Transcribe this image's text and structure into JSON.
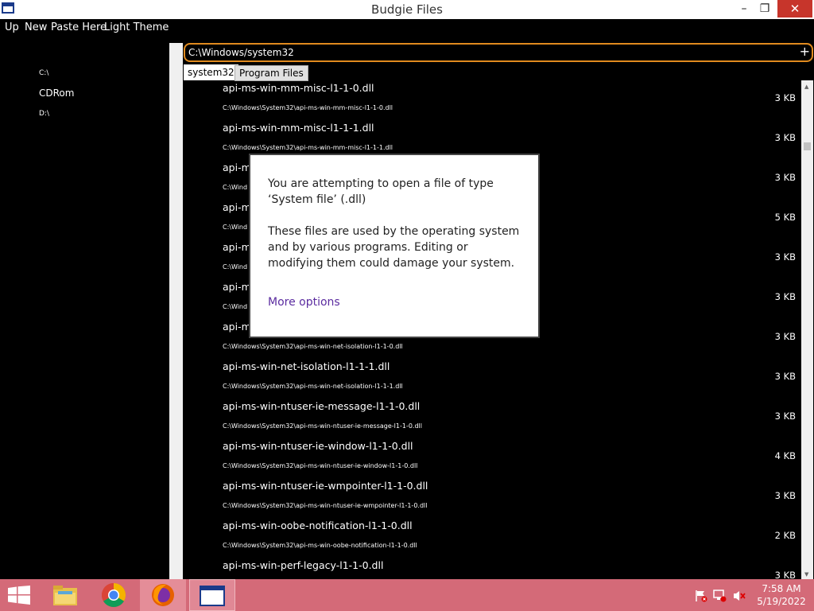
{
  "window": {
    "title": "Budgie Files",
    "controls": {
      "minimize": "–",
      "maximize": "❐",
      "close": "✕"
    }
  },
  "menu": {
    "up": "Up",
    "new": "New",
    "paste": "Paste Here",
    "theme": "Light Theme"
  },
  "sidebar": {
    "drives": [
      {
        "label": "C:\\"
      },
      {
        "label": "CDRom"
      },
      {
        "label": "D:\\"
      }
    ]
  },
  "address": {
    "value": "C:\\Windows/system32",
    "add_label": "+"
  },
  "tabs": [
    {
      "label": "system32"
    },
    {
      "label": "Program Files"
    }
  ],
  "files": [
    {
      "name": "api-ms-win-mm-misc-l1-1-0.dll",
      "path": "C:\\Windows\\System32\\api-ms-win-mm-misc-l1-1-0.dll",
      "size": "3 KB"
    },
    {
      "name": "api-ms-win-mm-misc-l1-1-1.dll",
      "path": "C:\\Windows\\System32\\api-ms-win-mm-misc-l1-1-1.dll",
      "size": "3 KB"
    },
    {
      "name": "api-m",
      "path": "C:\\Wind",
      "size": "3 KB"
    },
    {
      "name": "api-m",
      "path": "C:\\Wind",
      "size": "5 KB"
    },
    {
      "name": "api-m",
      "path": "C:\\Wind",
      "size": "3 KB"
    },
    {
      "name": "api-m",
      "path": "C:\\Wind",
      "size": "3 KB"
    },
    {
      "name": "api-m",
      "path": "C:\\Windows\\System32\\api-ms-win-net-isolation-l1-1-0.dll",
      "size": "3 KB"
    },
    {
      "name": "api-ms-win-net-isolation-l1-1-1.dll",
      "path": "C:\\Windows\\System32\\api-ms-win-net-isolation-l1-1-1.dll",
      "size": "3 KB"
    },
    {
      "name": "api-ms-win-ntuser-ie-message-l1-1-0.dll",
      "path": "C:\\Windows\\System32\\api-ms-win-ntuser-ie-message-l1-1-0.dll",
      "size": "3 KB"
    },
    {
      "name": "api-ms-win-ntuser-ie-window-l1-1-0.dll",
      "path": "C:\\Windows\\System32\\api-ms-win-ntuser-ie-window-l1-1-0.dll",
      "size": "4 KB"
    },
    {
      "name": "api-ms-win-ntuser-ie-wmpointer-l1-1-0.dll",
      "path": "C:\\Windows\\System32\\api-ms-win-ntuser-ie-wmpointer-l1-1-0.dll",
      "size": "3 KB"
    },
    {
      "name": "api-ms-win-oobe-notification-l1-1-0.dll",
      "path": "C:\\Windows\\System32\\api-ms-win-oobe-notification-l1-1-0.dll",
      "size": "2 KB"
    },
    {
      "name": "api-ms-win-perf-legacy-l1-1-0.dll",
      "path": "",
      "size": "3 KB"
    }
  ],
  "dialog": {
    "message1": "You are attempting to open a file of type ‘System file’ (.dll)",
    "message2": "These files are used by the operating system and by various programs. Editing or modifying them could damage your system.",
    "more_options": "More options"
  },
  "taskbar": {
    "apps": [
      "start-icon",
      "file-explorer-icon",
      "chrome-icon",
      "firefox-icon",
      "budgie-files-icon"
    ],
    "time": "7:58 AM",
    "date": "5/19/2022"
  },
  "colors": {
    "accent": "#e08a1e",
    "taskbar": "#d46a78",
    "link": "#5b2ca0",
    "close": "#c7352b"
  }
}
